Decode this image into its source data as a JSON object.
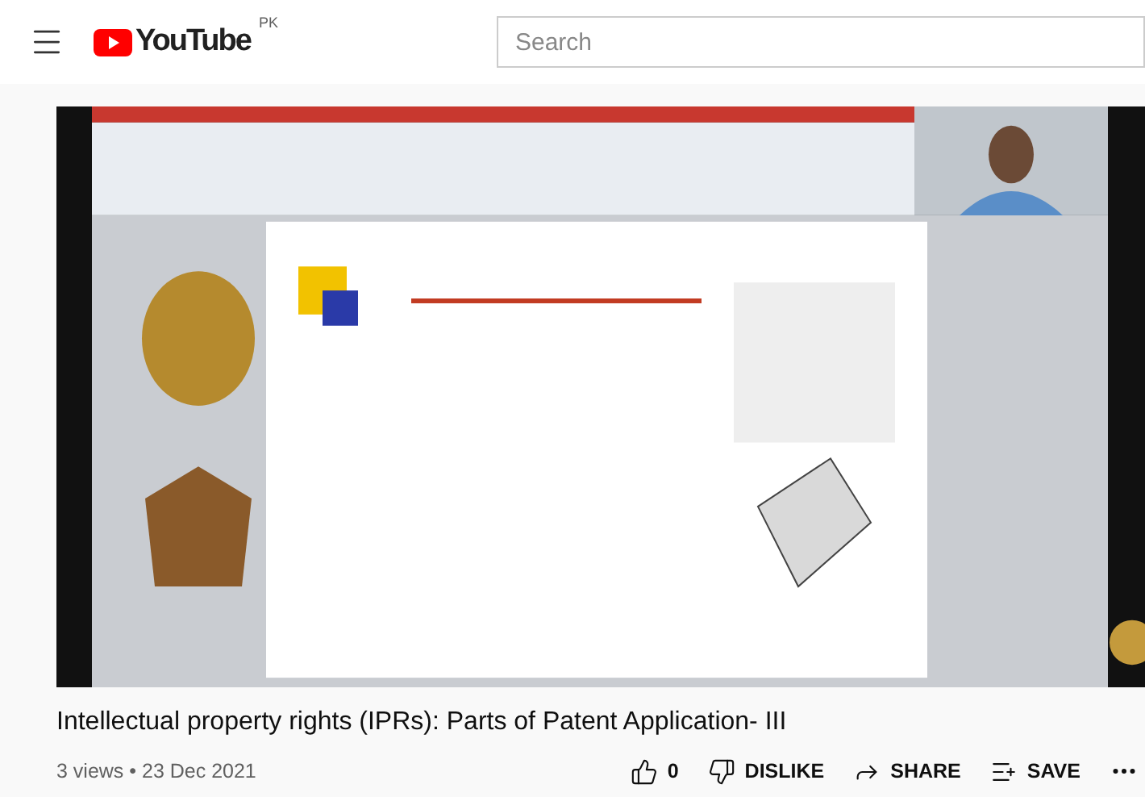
{
  "header": {
    "logo": "YouTube",
    "region": "PK",
    "search": {
      "placeholder": "Search"
    }
  },
  "title": "Intellectual property rights (IPRs): Parts of Patent Application- III",
  "meta": "3 views • 23 Dec 2021",
  "actions": [
    {
      "kind": "like",
      "label": "0"
    },
    {
      "kind": "dislike",
      "label": "DISLIKE"
    },
    {
      "kind": "share",
      "label": "SHARE"
    },
    {
      "kind": "save",
      "label": "SAVE"
    }
  ]
}
